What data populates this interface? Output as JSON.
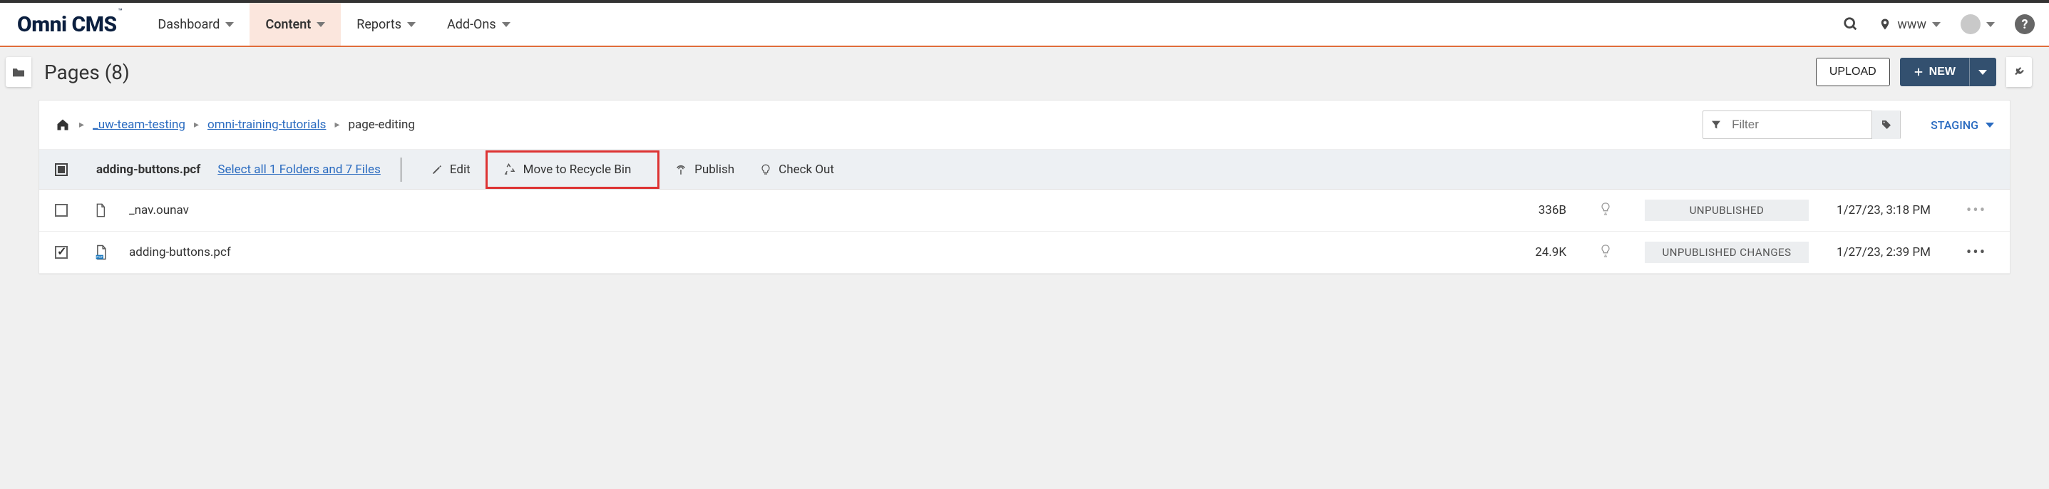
{
  "brand": "Omni CMS",
  "nav": {
    "items": [
      {
        "label": "Dashboard"
      },
      {
        "label": "Content",
        "active": true
      },
      {
        "label": "Reports"
      },
      {
        "label": "Add-Ons"
      }
    ]
  },
  "site_picker": {
    "label": "www"
  },
  "page": {
    "title": "Pages (8)",
    "upload_label": "UPLOAD",
    "new_label": "NEW"
  },
  "breadcrumbs": {
    "items": [
      {
        "label": "_uw-team-testing",
        "link": true
      },
      {
        "label": "omni-training-tutorials",
        "link": true
      },
      {
        "label": "page-editing",
        "link": false
      }
    ]
  },
  "filter": {
    "placeholder": "Filter"
  },
  "environment": {
    "label": "STAGING"
  },
  "selection": {
    "file": "adding-buttons.pcf",
    "select_all_label": "Select all 1 Folders and 7 Files",
    "actions": {
      "edit": "Edit",
      "recycle": "Move to Recycle Bin",
      "publish": "Publish",
      "checkout": "Check Out"
    }
  },
  "rows": [
    {
      "checked": false,
      "icon": "file",
      "name": "_nav.ounav",
      "size": "336B",
      "status": "UNPUBLISHED",
      "date": "1/27/23, 3:18 PM"
    },
    {
      "checked": true,
      "icon": "pcf",
      "name": "adding-buttons.pcf",
      "size": "24.9K",
      "status": "UNPUBLISHED CHANGES",
      "date": "1/27/23, 2:39 PM"
    }
  ]
}
